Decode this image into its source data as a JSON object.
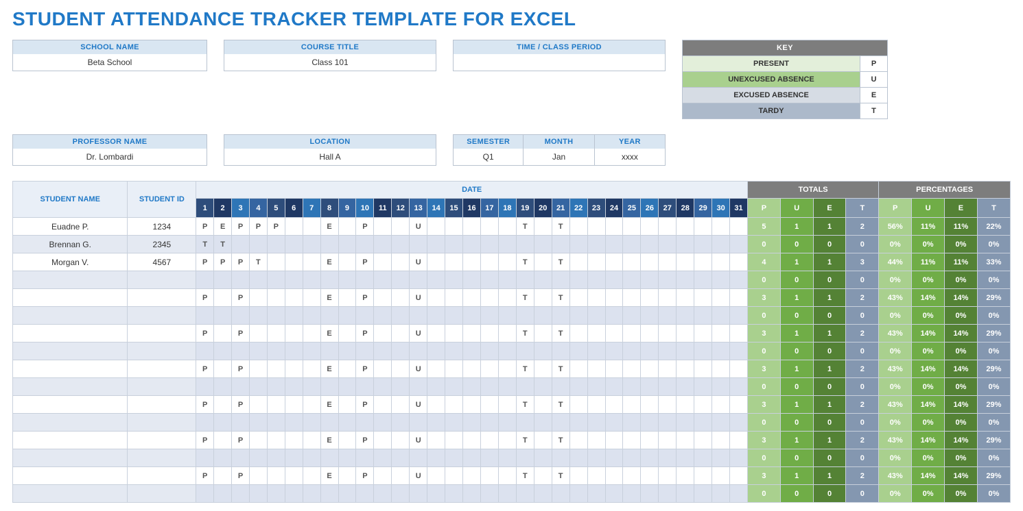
{
  "title": "STUDENT ATTENDANCE TRACKER TEMPLATE FOR EXCEL",
  "info": {
    "school_label": "SCHOOL NAME",
    "school_value": "Beta School",
    "course_label": "COURSE TITLE",
    "course_value": "Class 101",
    "time_label": "TIME / CLASS PERIOD",
    "time_value": "",
    "prof_label": "PROFESSOR NAME",
    "prof_value": "Dr. Lombardi",
    "loc_label": "LOCATION",
    "loc_value": "Hall A",
    "sem_label": "SEMESTER",
    "sem_value": "Q1",
    "month_label": "MONTH",
    "month_value": "Jan",
    "year_label": "YEAR",
    "year_value": "xxxx"
  },
  "key": {
    "header": "KEY",
    "items": [
      {
        "label": "PRESENT",
        "code": "P",
        "cls": "key-present"
      },
      {
        "label": "UNEXCUSED ABSENCE",
        "code": "U",
        "cls": "key-unexcused"
      },
      {
        "label": "EXCUSED ABSENCE",
        "code": "E",
        "cls": "key-excused"
      },
      {
        "label": "TARDY",
        "code": "T",
        "cls": "key-tardy"
      }
    ]
  },
  "headers": {
    "student_name": "STUDENT NAME",
    "student_id": "STUDENT ID",
    "date": "DATE",
    "totals": "TOTALS",
    "percentages": "PERCENTAGES",
    "tot_cols": [
      "P",
      "U",
      "E",
      "T",
      "P",
      "U",
      "E",
      "T"
    ]
  },
  "day_colors": [
    "#2e4d7b",
    "#1f3864",
    "#2e75b6",
    "#3565a1",
    "#2e4d7b",
    "#1f3864",
    "#2e75b6",
    "#2e4d7b",
    "#3565a1",
    "#2e75b6",
    "#1f3864",
    "#2e4d7b",
    "#3565a1",
    "#2e75b6",
    "#2e4d7b",
    "#1f3864",
    "#3565a1",
    "#2e75b6",
    "#2e4d7b",
    "#1f3864",
    "#3565a1",
    "#2e75b6",
    "#2e4d7b",
    "#1f3864",
    "#3565a1",
    "#2e75b6",
    "#2e4d7b",
    "#1f3864",
    "#3565a1",
    "#2e75b6",
    "#1f3864"
  ],
  "tot_colors": [
    "#a9d08e",
    "#70ad47",
    "#548235",
    "#8497b0",
    "#a9d08e",
    "#70ad47",
    "#548235",
    "#8497b0"
  ],
  "rows": [
    {
      "name": "Euadne P.",
      "id": "1234",
      "cells": [
        "P",
        "E",
        "P",
        "P",
        "P",
        "",
        "",
        "E",
        "",
        "P",
        "",
        "",
        "U",
        "",
        "",
        "",
        "",
        "",
        "T",
        "",
        "T",
        "",
        "",
        "",
        "",
        "",
        "",
        "",
        "",
        "",
        ""
      ],
      "tot": [
        "5",
        "1",
        "1",
        "2",
        "56%",
        "11%",
        "11%",
        "22%"
      ]
    },
    {
      "name": "Brennan G.",
      "id": "2345",
      "cells": [
        "T",
        "T",
        "",
        "",
        "",
        "",
        "",
        "",
        "",
        "",
        "",
        "",
        "",
        "",
        "",
        "",
        "",
        "",
        "",
        "",
        "",
        "",
        "",
        "",
        "",
        "",
        "",
        "",
        "",
        "",
        ""
      ],
      "tot": [
        "0",
        "0",
        "0",
        "0",
        "0%",
        "0%",
        "0%",
        "0%"
      ]
    },
    {
      "name": "Morgan V.",
      "id": "4567",
      "cells": [
        "P",
        "P",
        "P",
        "T",
        "",
        "",
        "",
        "E",
        "",
        "P",
        "",
        "",
        "U",
        "",
        "",
        "",
        "",
        "",
        "T",
        "",
        "T",
        "",
        "",
        "",
        "",
        "",
        "",
        "",
        "",
        "",
        ""
      ],
      "tot": [
        "4",
        "1",
        "1",
        "3",
        "44%",
        "11%",
        "11%",
        "33%"
      ]
    },
    {
      "name": "",
      "id": "",
      "cells": [
        "",
        "",
        "",
        "",
        "",
        "",
        "",
        "",
        "",
        "",
        "",
        "",
        "",
        "",
        "",
        "",
        "",
        "",
        "",
        "",
        "",
        "",
        "",
        "",
        "",
        "",
        "",
        "",
        "",
        "",
        ""
      ],
      "tot": [
        "0",
        "0",
        "0",
        "0",
        "0%",
        "0%",
        "0%",
        "0%"
      ]
    },
    {
      "name": "",
      "id": "",
      "cells": [
        "P",
        "",
        "P",
        "",
        "",
        "",
        "",
        "E",
        "",
        "P",
        "",
        "",
        "U",
        "",
        "",
        "",
        "",
        "",
        "T",
        "",
        "T",
        "",
        "",
        "",
        "",
        "",
        "",
        "",
        "",
        "",
        ""
      ],
      "tot": [
        "3",
        "1",
        "1",
        "2",
        "43%",
        "14%",
        "14%",
        "29%"
      ]
    },
    {
      "name": "",
      "id": "",
      "cells": [
        "",
        "",
        "",
        "",
        "",
        "",
        "",
        "",
        "",
        "",
        "",
        "",
        "",
        "",
        "",
        "",
        "",
        "",
        "",
        "",
        "",
        "",
        "",
        "",
        "",
        "",
        "",
        "",
        "",
        "",
        ""
      ],
      "tot": [
        "0",
        "0",
        "0",
        "0",
        "0%",
        "0%",
        "0%",
        "0%"
      ]
    },
    {
      "name": "",
      "id": "",
      "cells": [
        "P",
        "",
        "P",
        "",
        "",
        "",
        "",
        "E",
        "",
        "P",
        "",
        "",
        "U",
        "",
        "",
        "",
        "",
        "",
        "T",
        "",
        "T",
        "",
        "",
        "",
        "",
        "",
        "",
        "",
        "",
        "",
        ""
      ],
      "tot": [
        "3",
        "1",
        "1",
        "2",
        "43%",
        "14%",
        "14%",
        "29%"
      ]
    },
    {
      "name": "",
      "id": "",
      "cells": [
        "",
        "",
        "",
        "",
        "",
        "",
        "",
        "",
        "",
        "",
        "",
        "",
        "",
        "",
        "",
        "",
        "",
        "",
        "",
        "",
        "",
        "",
        "",
        "",
        "",
        "",
        "",
        "",
        "",
        "",
        ""
      ],
      "tot": [
        "0",
        "0",
        "0",
        "0",
        "0%",
        "0%",
        "0%",
        "0%"
      ]
    },
    {
      "name": "",
      "id": "",
      "cells": [
        "P",
        "",
        "P",
        "",
        "",
        "",
        "",
        "E",
        "",
        "P",
        "",
        "",
        "U",
        "",
        "",
        "",
        "",
        "",
        "T",
        "",
        "T",
        "",
        "",
        "",
        "",
        "",
        "",
        "",
        "",
        "",
        ""
      ],
      "tot": [
        "3",
        "1",
        "1",
        "2",
        "43%",
        "14%",
        "14%",
        "29%"
      ]
    },
    {
      "name": "",
      "id": "",
      "cells": [
        "",
        "",
        "",
        "",
        "",
        "",
        "",
        "",
        "",
        "",
        "",
        "",
        "",
        "",
        "",
        "",
        "",
        "",
        "",
        "",
        "",
        "",
        "",
        "",
        "",
        "",
        "",
        "",
        "",
        "",
        ""
      ],
      "tot": [
        "0",
        "0",
        "0",
        "0",
        "0%",
        "0%",
        "0%",
        "0%"
      ]
    },
    {
      "name": "",
      "id": "",
      "cells": [
        "P",
        "",
        "P",
        "",
        "",
        "",
        "",
        "E",
        "",
        "P",
        "",
        "",
        "U",
        "",
        "",
        "",
        "",
        "",
        "T",
        "",
        "T",
        "",
        "",
        "",
        "",
        "",
        "",
        "",
        "",
        "",
        ""
      ],
      "tot": [
        "3",
        "1",
        "1",
        "2",
        "43%",
        "14%",
        "14%",
        "29%"
      ]
    },
    {
      "name": "",
      "id": "",
      "cells": [
        "",
        "",
        "",
        "",
        "",
        "",
        "",
        "",
        "",
        "",
        "",
        "",
        "",
        "",
        "",
        "",
        "",
        "",
        "",
        "",
        "",
        "",
        "",
        "",
        "",
        "",
        "",
        "",
        "",
        "",
        ""
      ],
      "tot": [
        "0",
        "0",
        "0",
        "0",
        "0%",
        "0%",
        "0%",
        "0%"
      ]
    },
    {
      "name": "",
      "id": "",
      "cells": [
        "P",
        "",
        "P",
        "",
        "",
        "",
        "",
        "E",
        "",
        "P",
        "",
        "",
        "U",
        "",
        "",
        "",
        "",
        "",
        "T",
        "",
        "T",
        "",
        "",
        "",
        "",
        "",
        "",
        "",
        "",
        "",
        ""
      ],
      "tot": [
        "3",
        "1",
        "1",
        "2",
        "43%",
        "14%",
        "14%",
        "29%"
      ]
    },
    {
      "name": "",
      "id": "",
      "cells": [
        "",
        "",
        "",
        "",
        "",
        "",
        "",
        "",
        "",
        "",
        "",
        "",
        "",
        "",
        "",
        "",
        "",
        "",
        "",
        "",
        "",
        "",
        "",
        "",
        "",
        "",
        "",
        "",
        "",
        "",
        ""
      ],
      "tot": [
        "0",
        "0",
        "0",
        "0",
        "0%",
        "0%",
        "0%",
        "0%"
      ]
    },
    {
      "name": "",
      "id": "",
      "cells": [
        "P",
        "",
        "P",
        "",
        "",
        "",
        "",
        "E",
        "",
        "P",
        "",
        "",
        "U",
        "",
        "",
        "",
        "",
        "",
        "T",
        "",
        "T",
        "",
        "",
        "",
        "",
        "",
        "",
        "",
        "",
        "",
        ""
      ],
      "tot": [
        "3",
        "1",
        "1",
        "2",
        "43%",
        "14%",
        "14%",
        "29%"
      ]
    },
    {
      "name": "",
      "id": "",
      "cells": [
        "",
        "",
        "",
        "",
        "",
        "",
        "",
        "",
        "",
        "",
        "",
        "",
        "",
        "",
        "",
        "",
        "",
        "",
        "",
        "",
        "",
        "",
        "",
        "",
        "",
        "",
        "",
        "",
        "",
        "",
        ""
      ],
      "tot": [
        "0",
        "0",
        "0",
        "0",
        "0%",
        "0%",
        "0%",
        "0%"
      ]
    }
  ]
}
